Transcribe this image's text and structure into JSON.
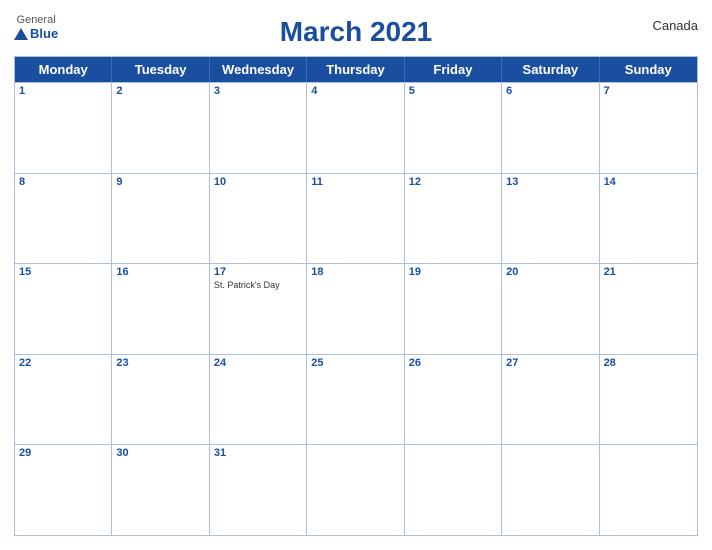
{
  "logo": {
    "general": "General",
    "blue": "Blue"
  },
  "title": "March 2021",
  "country": "Canada",
  "days_of_week": [
    "Monday",
    "Tuesday",
    "Wednesday",
    "Thursday",
    "Friday",
    "Saturday",
    "Sunday"
  ],
  "weeks": [
    [
      {
        "day": 1,
        "events": []
      },
      {
        "day": 2,
        "events": []
      },
      {
        "day": 3,
        "events": []
      },
      {
        "day": 4,
        "events": []
      },
      {
        "day": 5,
        "events": []
      },
      {
        "day": 6,
        "events": []
      },
      {
        "day": 7,
        "events": []
      }
    ],
    [
      {
        "day": 8,
        "events": []
      },
      {
        "day": 9,
        "events": []
      },
      {
        "day": 10,
        "events": []
      },
      {
        "day": 11,
        "events": []
      },
      {
        "day": 12,
        "events": []
      },
      {
        "day": 13,
        "events": []
      },
      {
        "day": 14,
        "events": []
      }
    ],
    [
      {
        "day": 15,
        "events": []
      },
      {
        "day": 16,
        "events": []
      },
      {
        "day": 17,
        "events": [
          "St. Patrick's Day"
        ]
      },
      {
        "day": 18,
        "events": []
      },
      {
        "day": 19,
        "events": []
      },
      {
        "day": 20,
        "events": []
      },
      {
        "day": 21,
        "events": []
      }
    ],
    [
      {
        "day": 22,
        "events": []
      },
      {
        "day": 23,
        "events": []
      },
      {
        "day": 24,
        "events": []
      },
      {
        "day": 25,
        "events": []
      },
      {
        "day": 26,
        "events": []
      },
      {
        "day": 27,
        "events": []
      },
      {
        "day": 28,
        "events": []
      }
    ],
    [
      {
        "day": 29,
        "events": []
      },
      {
        "day": 30,
        "events": []
      },
      {
        "day": 31,
        "events": []
      },
      {
        "day": null,
        "events": []
      },
      {
        "day": null,
        "events": []
      },
      {
        "day": null,
        "events": []
      },
      {
        "day": null,
        "events": []
      }
    ]
  ],
  "colors": {
    "header_bg": "#1a4fa0",
    "header_text": "#ffffff",
    "border": "#aac0e0",
    "day_number": "#1a4fa0",
    "title": "#1a4fa0"
  }
}
